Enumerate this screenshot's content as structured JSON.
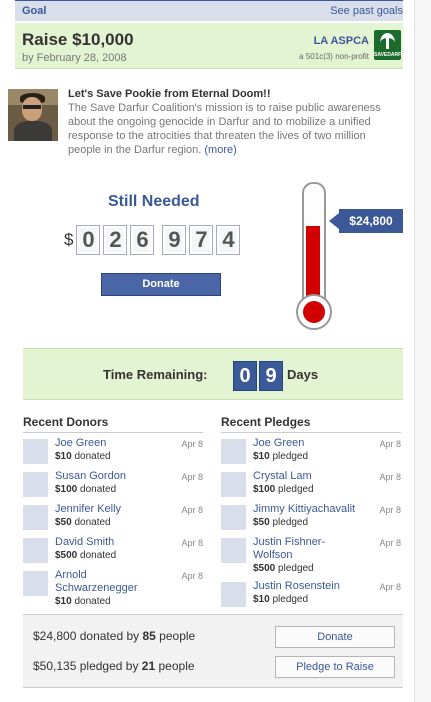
{
  "header": {
    "label": "Goal",
    "link": "See past goals"
  },
  "goal": {
    "title": "Raise $10,000",
    "date": "by February 28, 2008",
    "org_name": "LA ASPCA",
    "org_sub": "a 501c(3) non-profit",
    "logo_text": "SAVEDARFUR"
  },
  "story": {
    "title": "Let's Save Pookie from Eternal Doom!!",
    "body": "The Save Darfur Coalition's mission is to raise public awareness about the ongoing genocide in Darfur and to mobilize a unified response to the atrocities that threaten the lives of two million people in the Darfur region.",
    "more": "(more)"
  },
  "still_needed": {
    "label": "Still Needed",
    "currency": "$",
    "digits": [
      "0",
      "2",
      "6",
      "9",
      "7",
      "4"
    ],
    "donate": "Donate"
  },
  "thermometer": {
    "raised_label": "$24,800",
    "fill_fraction": 0.7
  },
  "time": {
    "label": "Time Remaining:",
    "digits": [
      "0",
      "9"
    ],
    "unit": "Days"
  },
  "donors": {
    "title": "Recent Donors",
    "items": [
      {
        "name": "Joe Green",
        "amount": "$10",
        "verb": "donated",
        "date": "Apr 8"
      },
      {
        "name": "Susan Gordon",
        "amount": "$100",
        "verb": "donated",
        "date": "Apr 8"
      },
      {
        "name": "Jennifer Kelly",
        "amount": "$50",
        "verb": "donated",
        "date": "Apr 8"
      },
      {
        "name": "David Smith",
        "amount": "$500",
        "verb": "donated",
        "date": "Apr 8"
      },
      {
        "name": "Arnold Schwarzenegger",
        "amount": "$10",
        "verb": "donated",
        "date": "Apr 8"
      }
    ]
  },
  "pledges": {
    "title": "Recent Pledges",
    "items": [
      {
        "name": "Joe Green",
        "amount": "$10",
        "verb": "pledged",
        "date": "Apr 8"
      },
      {
        "name": "Crystal Lam",
        "amount": "$100",
        "verb": "pledged",
        "date": "Apr 8"
      },
      {
        "name": "Jimmy Kittiyachavalit",
        "amount": "$50",
        "verb": "pledged",
        "date": "Apr 8"
      },
      {
        "name": "Justin Fishner-Wolfson",
        "amount": "$500",
        "verb": "pledged",
        "date": "Apr 8"
      },
      {
        "name": "Justin Rosenstein",
        "amount": "$10",
        "verb": "pledged",
        "date": "Apr 8"
      }
    ]
  },
  "summary": {
    "donated_amount": "$24,800",
    "donated_text": "donated by",
    "donated_count": "85",
    "donated_people": "people",
    "donate_button": "Donate",
    "pledged_amount": "$50,135",
    "pledged_text": "pledged by",
    "pledged_count": "21",
    "pledged_people": "people",
    "pledge_button": "Pledge to Raise"
  }
}
